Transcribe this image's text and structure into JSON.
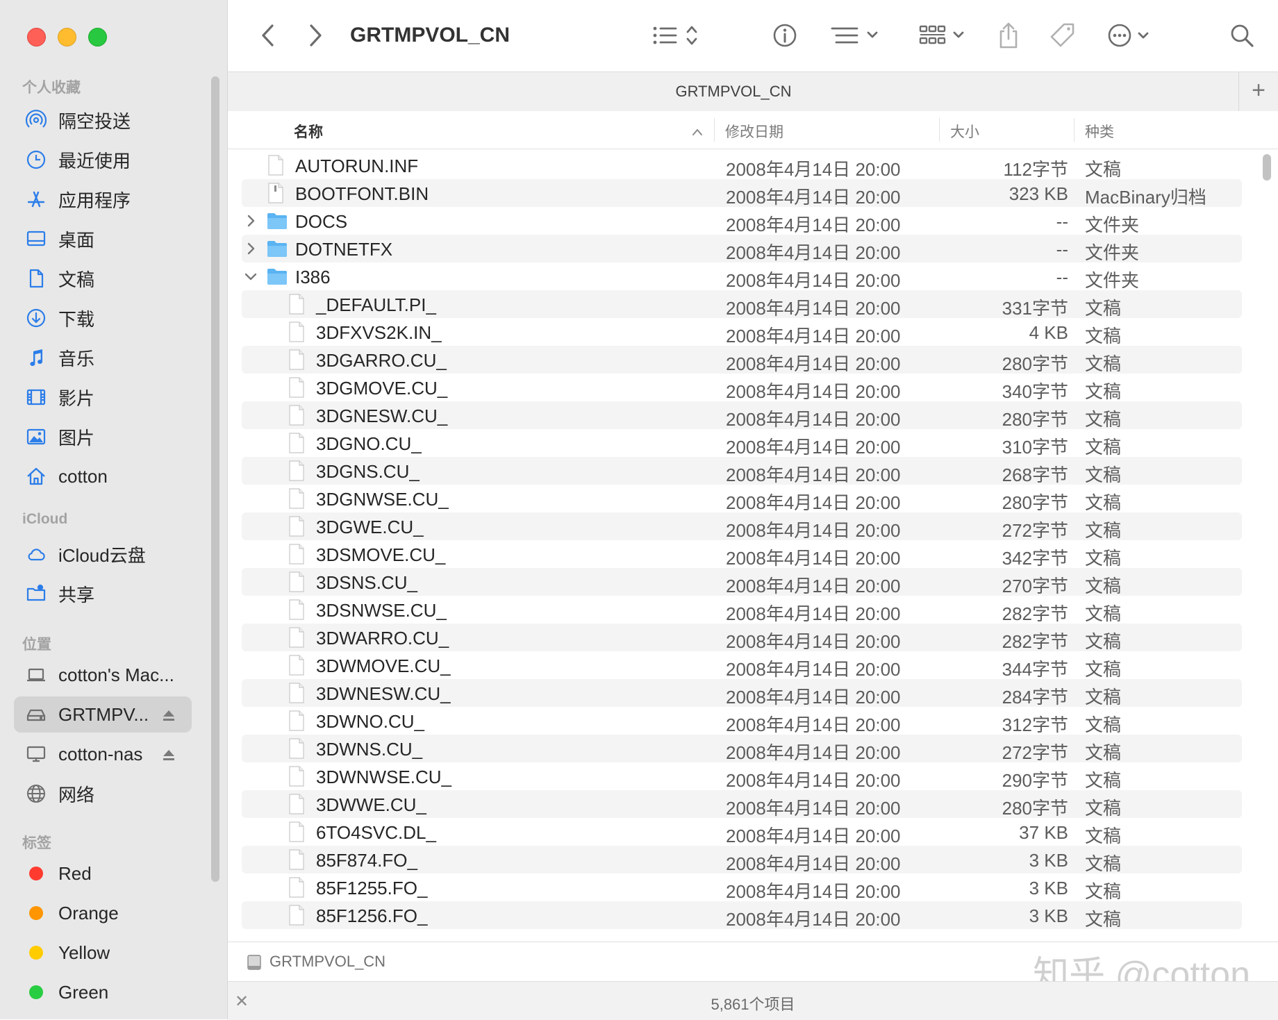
{
  "window": {
    "title": "GRTMPVOL_CN"
  },
  "toolbar": {
    "back_icon": "chevron-left-icon",
    "forward_icon": "chevron-right-icon",
    "title": "GRTMPVOL_CN"
  },
  "sidebar": {
    "sections": {
      "favorites": "个人收藏",
      "icloud": "iCloud",
      "locations": "位置",
      "tags": "标签"
    },
    "favorites": [
      {
        "label": "隔空投送",
        "icon": "airdrop-icon"
      },
      {
        "label": "最近使用",
        "icon": "clock-icon"
      },
      {
        "label": "应用程序",
        "icon": "applications-icon"
      },
      {
        "label": "桌面",
        "icon": "desktop-icon"
      },
      {
        "label": "文稿",
        "icon": "document-icon"
      },
      {
        "label": "下载",
        "icon": "download-icon"
      },
      {
        "label": "音乐",
        "icon": "music-icon"
      },
      {
        "label": "影片",
        "icon": "film-icon"
      },
      {
        "label": "图片",
        "icon": "photo-icon"
      },
      {
        "label": "cotton",
        "icon": "home-icon"
      }
    ],
    "icloud": [
      {
        "label": "iCloud云盘",
        "icon": "cloud-icon"
      },
      {
        "label": "共享",
        "icon": "shared-folder-icon"
      }
    ],
    "locations": [
      {
        "label": "cotton's Mac...",
        "icon": "laptop-icon"
      },
      {
        "label": "GRTMPV...",
        "icon": "drive-icon",
        "selected": true
      },
      {
        "label": "cotton-nas",
        "icon": "display-icon"
      },
      {
        "label": "网络",
        "icon": "network-icon"
      }
    ],
    "tags": [
      {
        "label": "Red",
        "color": "#ff3b30"
      },
      {
        "label": "Orange",
        "color": "#ff9500"
      },
      {
        "label": "Yellow",
        "color": "#ffcc00"
      },
      {
        "label": "Green",
        "color": "#28cd41"
      }
    ]
  },
  "tab": {
    "title": "GRTMPVOL_CN",
    "add_label": "+"
  },
  "columns": {
    "name": "名称",
    "date": "修改日期",
    "size": "大小",
    "kind": "种类"
  },
  "files": [
    {
      "name": "AUTORUN.INF",
      "date": "2008年4月14日 20:00",
      "size": "112字节",
      "kind": "文稿",
      "type": "file",
      "level": 0
    },
    {
      "name": "BOOTFONT.BIN",
      "date": "2008年4月14日 20:00",
      "size": "323 KB",
      "kind": "MacBinary归档",
      "type": "binary",
      "level": 0
    },
    {
      "name": "DOCS",
      "date": "2008年4月14日 20:00",
      "size": "--",
      "kind": "文件夹",
      "type": "folder",
      "level": 0,
      "expanded": false
    },
    {
      "name": "DOTNETFX",
      "date": "2008年4月14日 20:00",
      "size": "--",
      "kind": "文件夹",
      "type": "folder",
      "level": 0,
      "expanded": false
    },
    {
      "name": "I386",
      "date": "2008年4月14日 20:00",
      "size": "--",
      "kind": "文件夹",
      "type": "folder",
      "level": 0,
      "expanded": true
    },
    {
      "name": "_DEFAULT.PI_",
      "date": "2008年4月14日 20:00",
      "size": "331字节",
      "kind": "文稿",
      "type": "file",
      "level": 1
    },
    {
      "name": "3DFXVS2K.IN_",
      "date": "2008年4月14日 20:00",
      "size": "4 KB",
      "kind": "文稿",
      "type": "file",
      "level": 1
    },
    {
      "name": "3DGARRO.CU_",
      "date": "2008年4月14日 20:00",
      "size": "280字节",
      "kind": "文稿",
      "type": "file",
      "level": 1
    },
    {
      "name": "3DGMOVE.CU_",
      "date": "2008年4月14日 20:00",
      "size": "340字节",
      "kind": "文稿",
      "type": "file",
      "level": 1
    },
    {
      "name": "3DGNESW.CU_",
      "date": "2008年4月14日 20:00",
      "size": "280字节",
      "kind": "文稿",
      "type": "file",
      "level": 1
    },
    {
      "name": "3DGNO.CU_",
      "date": "2008年4月14日 20:00",
      "size": "310字节",
      "kind": "文稿",
      "type": "file",
      "level": 1
    },
    {
      "name": "3DGNS.CU_",
      "date": "2008年4月14日 20:00",
      "size": "268字节",
      "kind": "文稿",
      "type": "file",
      "level": 1
    },
    {
      "name": "3DGNWSE.CU_",
      "date": "2008年4月14日 20:00",
      "size": "280字节",
      "kind": "文稿",
      "type": "file",
      "level": 1
    },
    {
      "name": "3DGWE.CU_",
      "date": "2008年4月14日 20:00",
      "size": "272字节",
      "kind": "文稿",
      "type": "file",
      "level": 1
    },
    {
      "name": "3DSMOVE.CU_",
      "date": "2008年4月14日 20:00",
      "size": "342字节",
      "kind": "文稿",
      "type": "file",
      "level": 1
    },
    {
      "name": "3DSNS.CU_",
      "date": "2008年4月14日 20:00",
      "size": "270字节",
      "kind": "文稿",
      "type": "file",
      "level": 1
    },
    {
      "name": "3DSNWSE.CU_",
      "date": "2008年4月14日 20:00",
      "size": "282字节",
      "kind": "文稿",
      "type": "file",
      "level": 1
    },
    {
      "name": "3DWARRO.CU_",
      "date": "2008年4月14日 20:00",
      "size": "282字节",
      "kind": "文稿",
      "type": "file",
      "level": 1
    },
    {
      "name": "3DWMOVE.CU_",
      "date": "2008年4月14日 20:00",
      "size": "344字节",
      "kind": "文稿",
      "type": "file",
      "level": 1
    },
    {
      "name": "3DWNESW.CU_",
      "date": "2008年4月14日 20:00",
      "size": "284字节",
      "kind": "文稿",
      "type": "file",
      "level": 1
    },
    {
      "name": "3DWNO.CU_",
      "date": "2008年4月14日 20:00",
      "size": "312字节",
      "kind": "文稿",
      "type": "file",
      "level": 1
    },
    {
      "name": "3DWNS.CU_",
      "date": "2008年4月14日 20:00",
      "size": "272字节",
      "kind": "文稿",
      "type": "file",
      "level": 1
    },
    {
      "name": "3DWNWSE.CU_",
      "date": "2008年4月14日 20:00",
      "size": "290字节",
      "kind": "文稿",
      "type": "file",
      "level": 1
    },
    {
      "name": "3DWWE.CU_",
      "date": "2008年4月14日 20:00",
      "size": "280字节",
      "kind": "文稿",
      "type": "file",
      "level": 1
    },
    {
      "name": "6TO4SVC.DL_",
      "date": "2008年4月14日 20:00",
      "size": "37 KB",
      "kind": "文稿",
      "type": "file",
      "level": 1
    },
    {
      "name": "85F874.FO_",
      "date": "2008年4月14日 20:00",
      "size": "3 KB",
      "kind": "文稿",
      "type": "file",
      "level": 1
    },
    {
      "name": "85F1255.FO_",
      "date": "2008年4月14日 20:00",
      "size": "3 KB",
      "kind": "文稿",
      "type": "file",
      "level": 1
    },
    {
      "name": "85F1256.FO_",
      "date": "2008年4月14日 20:00",
      "size": "3 KB",
      "kind": "文稿",
      "type": "file",
      "level": 1
    }
  ],
  "pathbar": {
    "path": "GRTMPVOL_CN",
    "watermark": "知乎 @cotton"
  },
  "status": {
    "count": "5,861个项目"
  }
}
